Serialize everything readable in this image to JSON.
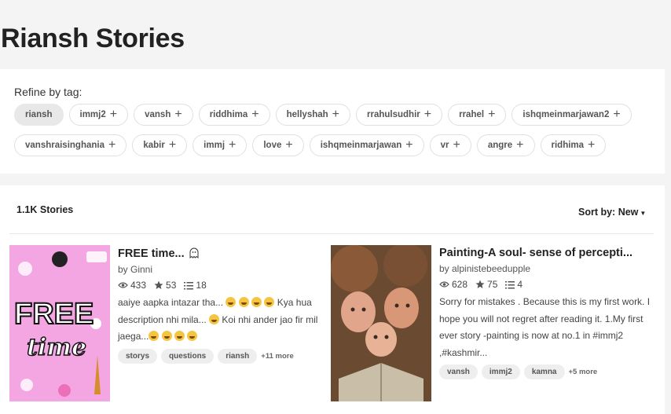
{
  "page_title": "Riansh Stories",
  "refine_label": "Refine by tag:",
  "tags_row1": [
    "riansh",
    "immj2",
    "vansh",
    "riddhima",
    "hellyshah",
    "rrahulsudhir",
    "rrahel",
    "ishqmeinmarjawan2"
  ],
  "tags_row2": [
    "vanshraisinghania",
    "kabir",
    "immj",
    "love",
    "ishqmeinmarjawan",
    "vr",
    "angre",
    "ridhima"
  ],
  "active_tag": "riansh",
  "stories_count": "1.1K Stories",
  "sort_label": "Sort by: New",
  "stories": [
    {
      "title": "FREE time... ",
      "author": "by Ginni",
      "reads": "433",
      "votes": "53",
      "parts": "18",
      "desc_parts": [
        "aaiye aapka intazar tha... ",
        " Kya hua description nhi mila... ",
        " Koi nhi ander jao fir mil jaega..."
      ],
      "tags": [
        "storys",
        "questions",
        "riansh"
      ],
      "more": "+11 more"
    },
    {
      "title": "Painting-A soul- sense of percepti...",
      "author": "by alpinistebeedupple",
      "reads": "628",
      "votes": "75",
      "parts": "4",
      "description": "Sorry for mistakes . Because this is my first work. I hope you will not regret after reading it. 1.My first ever story -painting is now at no.1 in #immj2 ,#kashmir...",
      "tags": [
        "vansh",
        "immj2",
        "kamna"
      ],
      "more": "+5 more"
    }
  ],
  "colors": {
    "accent": "#222222",
    "tag_active_bg": "#e8e8e8",
    "cover1_bg": "#f4a6e3"
  },
  "icons": {
    "reads": "eye-icon",
    "votes": "star-icon",
    "parts": "list-icon",
    "sort": "caret-down-icon",
    "tag_add": "plus-icon"
  }
}
